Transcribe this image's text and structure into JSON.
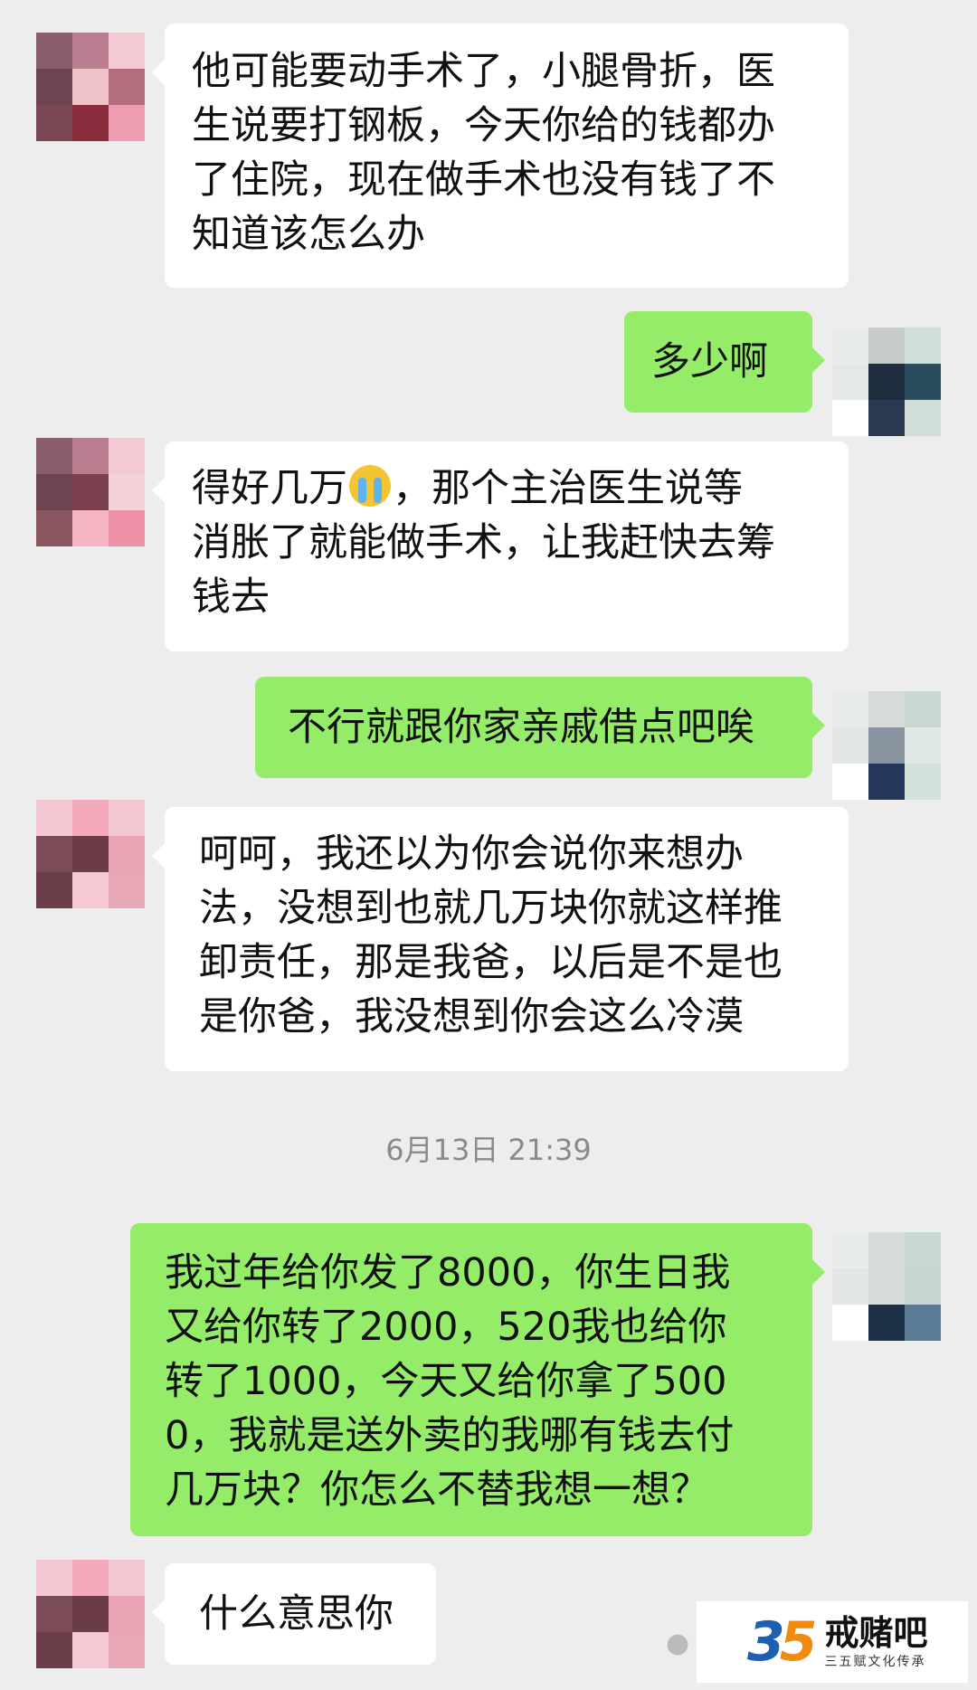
{
  "messages": [
    {
      "from": "contact",
      "lines": [
        "他可能要动手术了，小腿骨折，医",
        "生说要打钢板，今天你给的钱都办",
        "了住院，现在做手术也没有钱了不",
        "知道该怎么办"
      ]
    },
    {
      "from": "me",
      "lines": [
        "多少啊"
      ]
    },
    {
      "from": "contact",
      "lines_before_emoji": "得好几万",
      "emoji": "crying-face-emoji",
      "lines_after_emoji": "，那个主治医生说等",
      "lines": [
        "消胀了就能做手术，让我赶快去筹",
        "钱去"
      ]
    },
    {
      "from": "me",
      "lines": [
        "不行就跟你家亲戚借点吧唉"
      ]
    },
    {
      "from": "contact",
      "lines": [
        "呵呵，我还以为你会说你来想办",
        "法，没想到也就几万块你就这样推",
        "卸责任，那是我爸，以后是不是也",
        "是你爸，我没想到你会这么冷漠"
      ]
    },
    {
      "from": "me",
      "lines": [
        "我过年给你发了8000，你生日我",
        "又给你转了2000，520我也给你",
        "转了1000，今天又给你拿了500",
        "0，我就是送外卖的我哪有钱去付",
        "几万块？你怎么不替我想一想？"
      ]
    },
    {
      "from": "contact",
      "lines": [
        "什么意思你"
      ]
    }
  ],
  "timestamp": "6月13日 21:39",
  "watermark": {
    "logo": "35",
    "logo_d1": "3",
    "logo_d2": "5",
    "title": "戒赌吧",
    "subtitle": "三五赋文化传承"
  },
  "colors": {
    "background": "#ededed",
    "incoming_bubble": "#ffffff",
    "outgoing_bubble": "#95ec69"
  }
}
